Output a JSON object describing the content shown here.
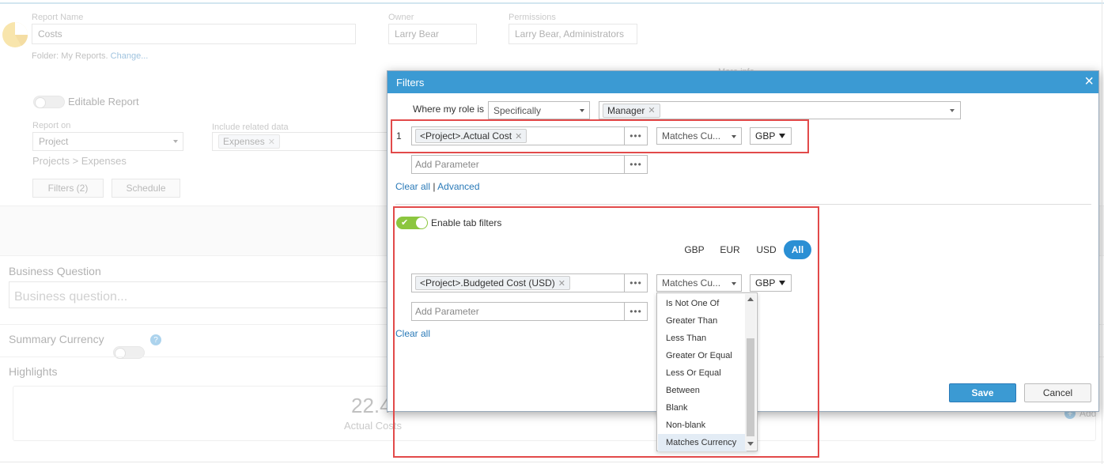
{
  "background": {
    "report_name_label": "Report Name",
    "report_name_value": "Costs",
    "folder_text": "Folder: My Reports.",
    "folder_change": "Change...",
    "owner_label": "Owner",
    "owner_value": "Larry Bear",
    "permissions_label": "Permissions",
    "permissions_value": "Larry Bear, Administrators",
    "more_info": "More info",
    "editable_report": "Editable Report",
    "report_on_label": "Report on",
    "report_on_value": "Project",
    "include_related_label": "Include related data",
    "include_related_tag": "Expenses",
    "breadcrumb": "Projects > Expenses",
    "filters_button": "Filters (2)",
    "schedule_button": "Schedule",
    "business_question_label": "Business Question",
    "business_question_placeholder": "Business question...",
    "summary_currency_label": "Summary Currency",
    "help_icon": "?",
    "highlights_label": "Highlights",
    "highlight_value": "22.4",
    "highlight_caption": "Actual Costs",
    "add_label": "Add"
  },
  "dialog": {
    "title": "Filters",
    "close_icon": "×",
    "role_label": "Where my role is",
    "role_mode": "Specifically",
    "role_tag": "Manager",
    "row1_index": "1",
    "row1_tag": "<Project>.Actual Cost",
    "row1_operator": "Matches Cu...",
    "row1_currency": "GBP",
    "dots_label": "•••",
    "add_parameter_placeholder": "Add Parameter",
    "clear_all": "Clear all",
    "separator": "|",
    "advanced": "Advanced",
    "enable_tab_filters": "Enable tab filters",
    "currency_tabs": [
      "GBP",
      "EUR",
      "USD",
      "All"
    ],
    "row2_tag": "<Project>.Budgeted Cost (USD)",
    "row2_operator": "Matches Cu...",
    "row2_currency": "GBP",
    "clear_all_2": "Clear all",
    "save": "Save",
    "cancel": "Cancel"
  },
  "dropdown": {
    "options": [
      "Is Not One Of",
      "Greater Than",
      "Less Than",
      "Greater Or Equal",
      "Less Or Equal",
      "Between",
      "Blank",
      "Non-blank",
      "Matches Currency"
    ],
    "selected": "Matches Currency"
  },
  "colors": {
    "header_blue": "#3b9ad3",
    "highlight_red": "#e24a4a",
    "toggle_green": "#8cc63f"
  }
}
